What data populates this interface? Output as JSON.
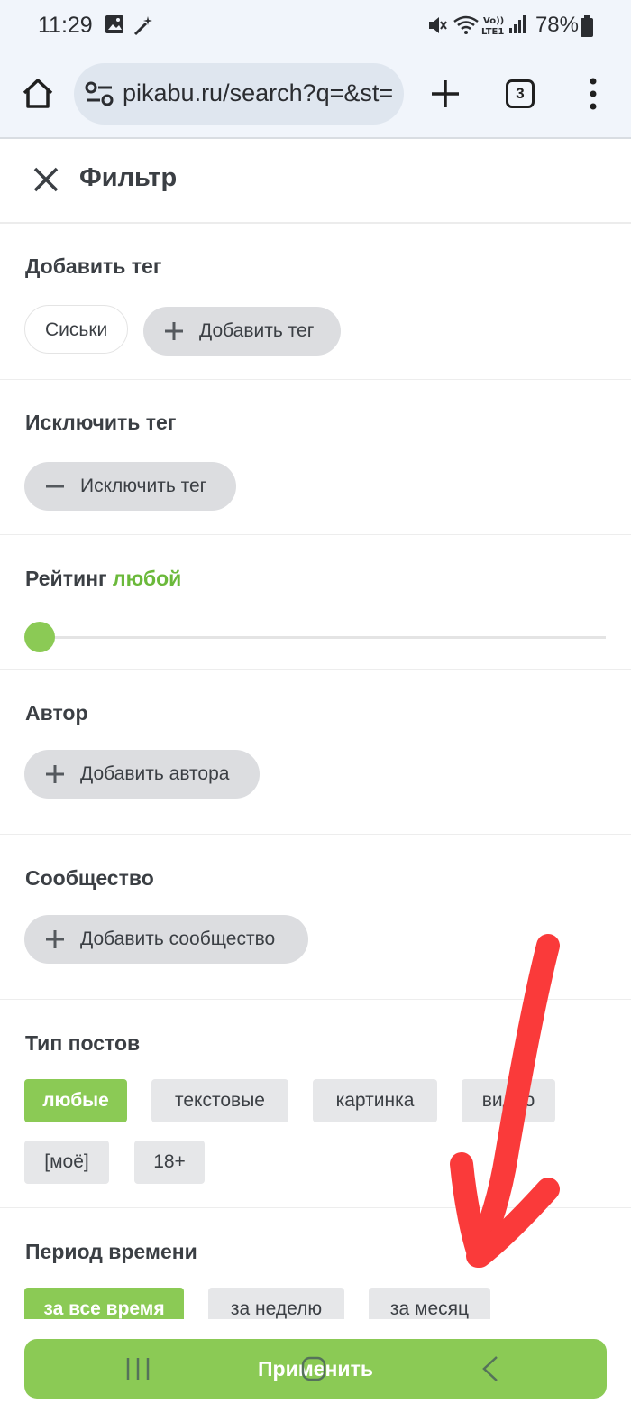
{
  "status_bar": {
    "time": "11:29",
    "battery": "78%",
    "icons": [
      "gallery-icon",
      "magic-wand-icon",
      "mute-icon",
      "wifi-icon",
      "volte-icon",
      "signal-icon",
      "battery-icon"
    ]
  },
  "browser": {
    "url": "pikabu.ru/search?q=&st=",
    "tab_count": "3",
    "icons": [
      "home-icon",
      "site-settings-icon",
      "plus-icon",
      "tabs-icon",
      "more-vert-icon"
    ]
  },
  "header": {
    "title": "Фильтр"
  },
  "add_tag": {
    "title": "Добавить тег",
    "tags": [
      "Сиськи"
    ],
    "button_label": "Добавить тег"
  },
  "exclude_tag": {
    "title": "Исключить тег",
    "button_label": "Исключить тег"
  },
  "rating": {
    "title": "Рейтинг",
    "value_label": "любой",
    "slider_value": 0,
    "accent_color": "#8bca55"
  },
  "author": {
    "title": "Автор",
    "button_label": "Добавить автора"
  },
  "community": {
    "title": "Сообщество",
    "button_label": "Добавить сообщество"
  },
  "post_type": {
    "title": "Тип постов",
    "options": [
      "любые",
      "текстовые",
      "картинка",
      "видео",
      "[моё]",
      "18+"
    ],
    "selected": "любые"
  },
  "period": {
    "title": "Период времени",
    "options": [
      "за все время",
      "за неделю",
      "за месяц"
    ],
    "selected": "за все время"
  },
  "apply": {
    "label": "Применить"
  },
  "nav": {
    "icons": [
      "recents-icon",
      "home-nav-icon",
      "back-icon"
    ]
  },
  "overlay": {
    "color": "#fa3a3a",
    "shape": "hand-drawn-arrow"
  }
}
